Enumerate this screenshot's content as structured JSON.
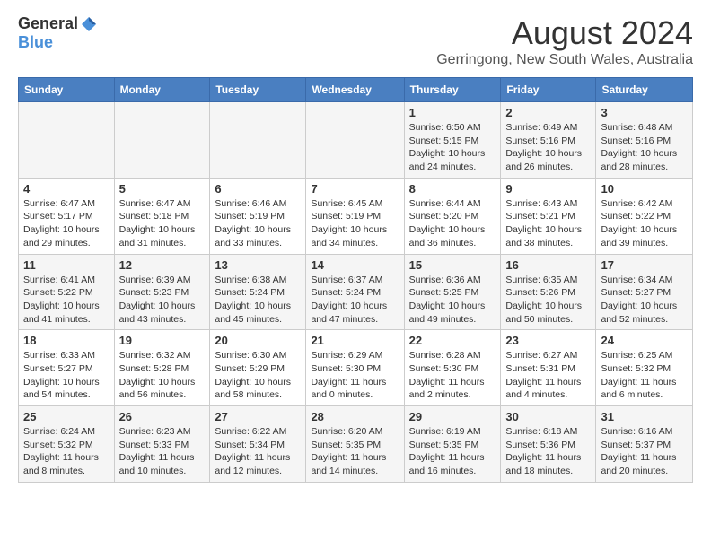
{
  "header": {
    "logo_general": "General",
    "logo_blue": "Blue",
    "month_title": "August 2024",
    "subtitle": "Gerringong, New South Wales, Australia"
  },
  "days_of_week": [
    "Sunday",
    "Monday",
    "Tuesday",
    "Wednesday",
    "Thursday",
    "Friday",
    "Saturday"
  ],
  "weeks": [
    [
      {
        "day": "",
        "info": ""
      },
      {
        "day": "",
        "info": ""
      },
      {
        "day": "",
        "info": ""
      },
      {
        "day": "",
        "info": ""
      },
      {
        "day": "1",
        "info": "Sunrise: 6:50 AM\nSunset: 5:15 PM\nDaylight: 10 hours\nand 24 minutes."
      },
      {
        "day": "2",
        "info": "Sunrise: 6:49 AM\nSunset: 5:16 PM\nDaylight: 10 hours\nand 26 minutes."
      },
      {
        "day": "3",
        "info": "Sunrise: 6:48 AM\nSunset: 5:16 PM\nDaylight: 10 hours\nand 28 minutes."
      }
    ],
    [
      {
        "day": "4",
        "info": "Sunrise: 6:47 AM\nSunset: 5:17 PM\nDaylight: 10 hours\nand 29 minutes."
      },
      {
        "day": "5",
        "info": "Sunrise: 6:47 AM\nSunset: 5:18 PM\nDaylight: 10 hours\nand 31 minutes."
      },
      {
        "day": "6",
        "info": "Sunrise: 6:46 AM\nSunset: 5:19 PM\nDaylight: 10 hours\nand 33 minutes."
      },
      {
        "day": "7",
        "info": "Sunrise: 6:45 AM\nSunset: 5:19 PM\nDaylight: 10 hours\nand 34 minutes."
      },
      {
        "day": "8",
        "info": "Sunrise: 6:44 AM\nSunset: 5:20 PM\nDaylight: 10 hours\nand 36 minutes."
      },
      {
        "day": "9",
        "info": "Sunrise: 6:43 AM\nSunset: 5:21 PM\nDaylight: 10 hours\nand 38 minutes."
      },
      {
        "day": "10",
        "info": "Sunrise: 6:42 AM\nSunset: 5:22 PM\nDaylight: 10 hours\nand 39 minutes."
      }
    ],
    [
      {
        "day": "11",
        "info": "Sunrise: 6:41 AM\nSunset: 5:22 PM\nDaylight: 10 hours\nand 41 minutes."
      },
      {
        "day": "12",
        "info": "Sunrise: 6:39 AM\nSunset: 5:23 PM\nDaylight: 10 hours\nand 43 minutes."
      },
      {
        "day": "13",
        "info": "Sunrise: 6:38 AM\nSunset: 5:24 PM\nDaylight: 10 hours\nand 45 minutes."
      },
      {
        "day": "14",
        "info": "Sunrise: 6:37 AM\nSunset: 5:24 PM\nDaylight: 10 hours\nand 47 minutes."
      },
      {
        "day": "15",
        "info": "Sunrise: 6:36 AM\nSunset: 5:25 PM\nDaylight: 10 hours\nand 49 minutes."
      },
      {
        "day": "16",
        "info": "Sunrise: 6:35 AM\nSunset: 5:26 PM\nDaylight: 10 hours\nand 50 minutes."
      },
      {
        "day": "17",
        "info": "Sunrise: 6:34 AM\nSunset: 5:27 PM\nDaylight: 10 hours\nand 52 minutes."
      }
    ],
    [
      {
        "day": "18",
        "info": "Sunrise: 6:33 AM\nSunset: 5:27 PM\nDaylight: 10 hours\nand 54 minutes."
      },
      {
        "day": "19",
        "info": "Sunrise: 6:32 AM\nSunset: 5:28 PM\nDaylight: 10 hours\nand 56 minutes."
      },
      {
        "day": "20",
        "info": "Sunrise: 6:30 AM\nSunset: 5:29 PM\nDaylight: 10 hours\nand 58 minutes."
      },
      {
        "day": "21",
        "info": "Sunrise: 6:29 AM\nSunset: 5:30 PM\nDaylight: 11 hours\nand 0 minutes."
      },
      {
        "day": "22",
        "info": "Sunrise: 6:28 AM\nSunset: 5:30 PM\nDaylight: 11 hours\nand 2 minutes."
      },
      {
        "day": "23",
        "info": "Sunrise: 6:27 AM\nSunset: 5:31 PM\nDaylight: 11 hours\nand 4 minutes."
      },
      {
        "day": "24",
        "info": "Sunrise: 6:25 AM\nSunset: 5:32 PM\nDaylight: 11 hours\nand 6 minutes."
      }
    ],
    [
      {
        "day": "25",
        "info": "Sunrise: 6:24 AM\nSunset: 5:32 PM\nDaylight: 11 hours\nand 8 minutes."
      },
      {
        "day": "26",
        "info": "Sunrise: 6:23 AM\nSunset: 5:33 PM\nDaylight: 11 hours\nand 10 minutes."
      },
      {
        "day": "27",
        "info": "Sunrise: 6:22 AM\nSunset: 5:34 PM\nDaylight: 11 hours\nand 12 minutes."
      },
      {
        "day": "28",
        "info": "Sunrise: 6:20 AM\nSunset: 5:35 PM\nDaylight: 11 hours\nand 14 minutes."
      },
      {
        "day": "29",
        "info": "Sunrise: 6:19 AM\nSunset: 5:35 PM\nDaylight: 11 hours\nand 16 minutes."
      },
      {
        "day": "30",
        "info": "Sunrise: 6:18 AM\nSunset: 5:36 PM\nDaylight: 11 hours\nand 18 minutes."
      },
      {
        "day": "31",
        "info": "Sunrise: 6:16 AM\nSunset: 5:37 PM\nDaylight: 11 hours\nand 20 minutes."
      }
    ]
  ]
}
